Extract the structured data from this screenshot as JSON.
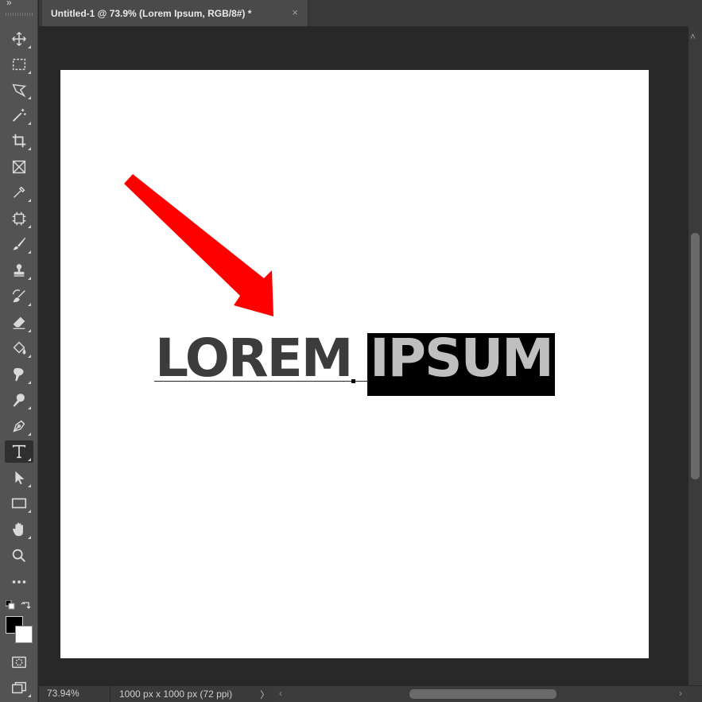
{
  "tab": {
    "title": "Untitled-1 @ 73.9% (Lorem Ipsum, RGB/8#) *",
    "close": "×"
  },
  "toolbar": {
    "collapse": "»",
    "tools": [
      {
        "name": "move-tool",
        "icon": "move-icon"
      },
      {
        "name": "marquee-tool",
        "icon": "rectangular-marquee-icon"
      },
      {
        "name": "lasso-tool",
        "icon": "polygonal-lasso-icon"
      },
      {
        "name": "magic-wand-tool",
        "icon": "magic-wand-icon"
      },
      {
        "name": "crop-tool",
        "icon": "crop-icon"
      },
      {
        "name": "frame-tool",
        "icon": "frame-icon"
      },
      {
        "name": "eyedropper-tool",
        "icon": "eyedropper-icon"
      },
      {
        "name": "healing-brush-tool",
        "icon": "healing-brush-icon"
      },
      {
        "name": "brush-tool",
        "icon": "brush-icon"
      },
      {
        "name": "clone-stamp-tool",
        "icon": "stamp-icon"
      },
      {
        "name": "history-brush-tool",
        "icon": "history-brush-icon"
      },
      {
        "name": "eraser-tool",
        "icon": "eraser-icon"
      },
      {
        "name": "paint-bucket-tool",
        "icon": "paint-bucket-icon"
      },
      {
        "name": "smudge-tool",
        "icon": "smudge-icon"
      },
      {
        "name": "dodge-tool",
        "icon": "dodge-icon"
      },
      {
        "name": "pen-tool",
        "icon": "pen-icon"
      },
      {
        "name": "type-tool",
        "icon": "type-icon",
        "active": true
      },
      {
        "name": "path-selection-tool",
        "icon": "path-selection-icon"
      },
      {
        "name": "rectangle-tool",
        "icon": "rectangle-icon"
      },
      {
        "name": "hand-tool",
        "icon": "hand-icon"
      },
      {
        "name": "zoom-tool",
        "icon": "zoom-icon"
      },
      {
        "name": "edit-toolbar",
        "icon": "more-icon"
      }
    ],
    "foreground_color": "#000000",
    "background_color": "#ffffff"
  },
  "canvas": {
    "text_unselected": "LOREM ",
    "text_selected": "IPSUM",
    "arrow_color": "#ff0000",
    "text_color": "#3c3c3c",
    "selection_color": "#000000",
    "selected_text_color": "#bfbfbf"
  },
  "status": {
    "zoom": "73.94%",
    "doc_info": "1000 px x 1000 px (72 ppi)",
    "more": "〉"
  },
  "scroll": {
    "left": "‹",
    "right": "›",
    "up": "˄"
  }
}
